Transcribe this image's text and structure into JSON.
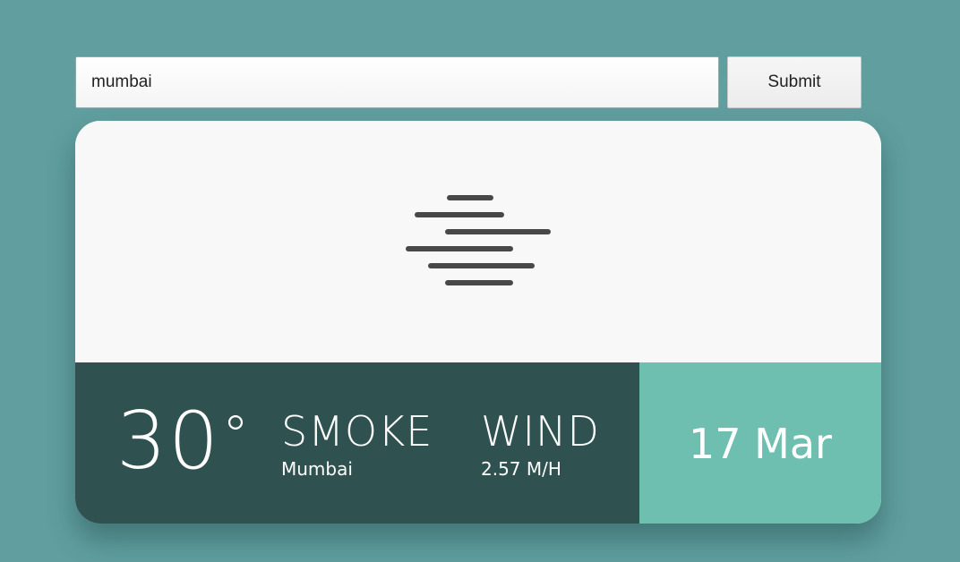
{
  "search": {
    "value": "mumbai",
    "submit_label": "Submit"
  },
  "weather": {
    "icon": "haze-icon",
    "temperature": "30",
    "degree_symbol": "°",
    "condition": "SMOKE",
    "city": "Mumbai",
    "wind_label": "WIND",
    "wind_speed": "2.57 M/H",
    "date": "17 Mar"
  },
  "colors": {
    "background": "#609e9f",
    "card_top": "#f8f8f8",
    "card_bottom_dark": "#2f5150",
    "card_bottom_accent": "#6fbfb0",
    "icon_color": "#484848"
  }
}
